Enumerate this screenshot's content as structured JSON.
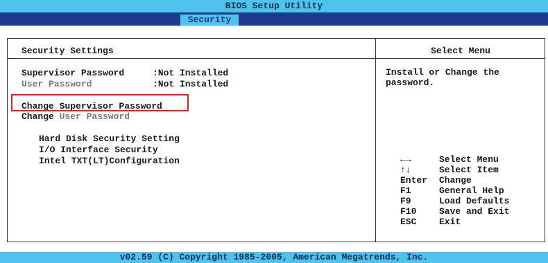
{
  "title": "BIOS Setup Utility",
  "tab": "Security",
  "main": {
    "section_title": "Security Settings",
    "status_rows": [
      {
        "label": "Supervisor Password",
        "value": ":Not Installed"
      },
      {
        "label": "User Password",
        "value": ":Not Installed"
      }
    ],
    "change_supervisor": "Change Supervisor Password",
    "change_user_prefix": "Change",
    "change_user_rest": "User Password",
    "submenus": [
      "Hard Disk Security Setting",
      "I/O Interface Security",
      "Intel TXT(LT)Configuration"
    ]
  },
  "help": {
    "title": "Select Menu",
    "text": "Install or Change the\npassword."
  },
  "keys": [
    {
      "key": "←→",
      "action": "Select Menu"
    },
    {
      "key": "↑↓",
      "action": "Select Item"
    },
    {
      "key": "Enter",
      "action": "Change"
    },
    {
      "key": "F1",
      "action": "General Help"
    },
    {
      "key": "F9",
      "action": "Load Defaults"
    },
    {
      "key": "F10",
      "action": "Save and Exit"
    },
    {
      "key": "ESC",
      "action": "Exit"
    }
  ],
  "footer": "v02.59 (C) Copyright 1985-2005, American Megatrends, Inc.",
  "colors": {
    "bar": "#4fc3ee",
    "tab_bar": "#1d3a8c",
    "highlight": "#e02020",
    "disabled_text": "#7a7a7a"
  }
}
